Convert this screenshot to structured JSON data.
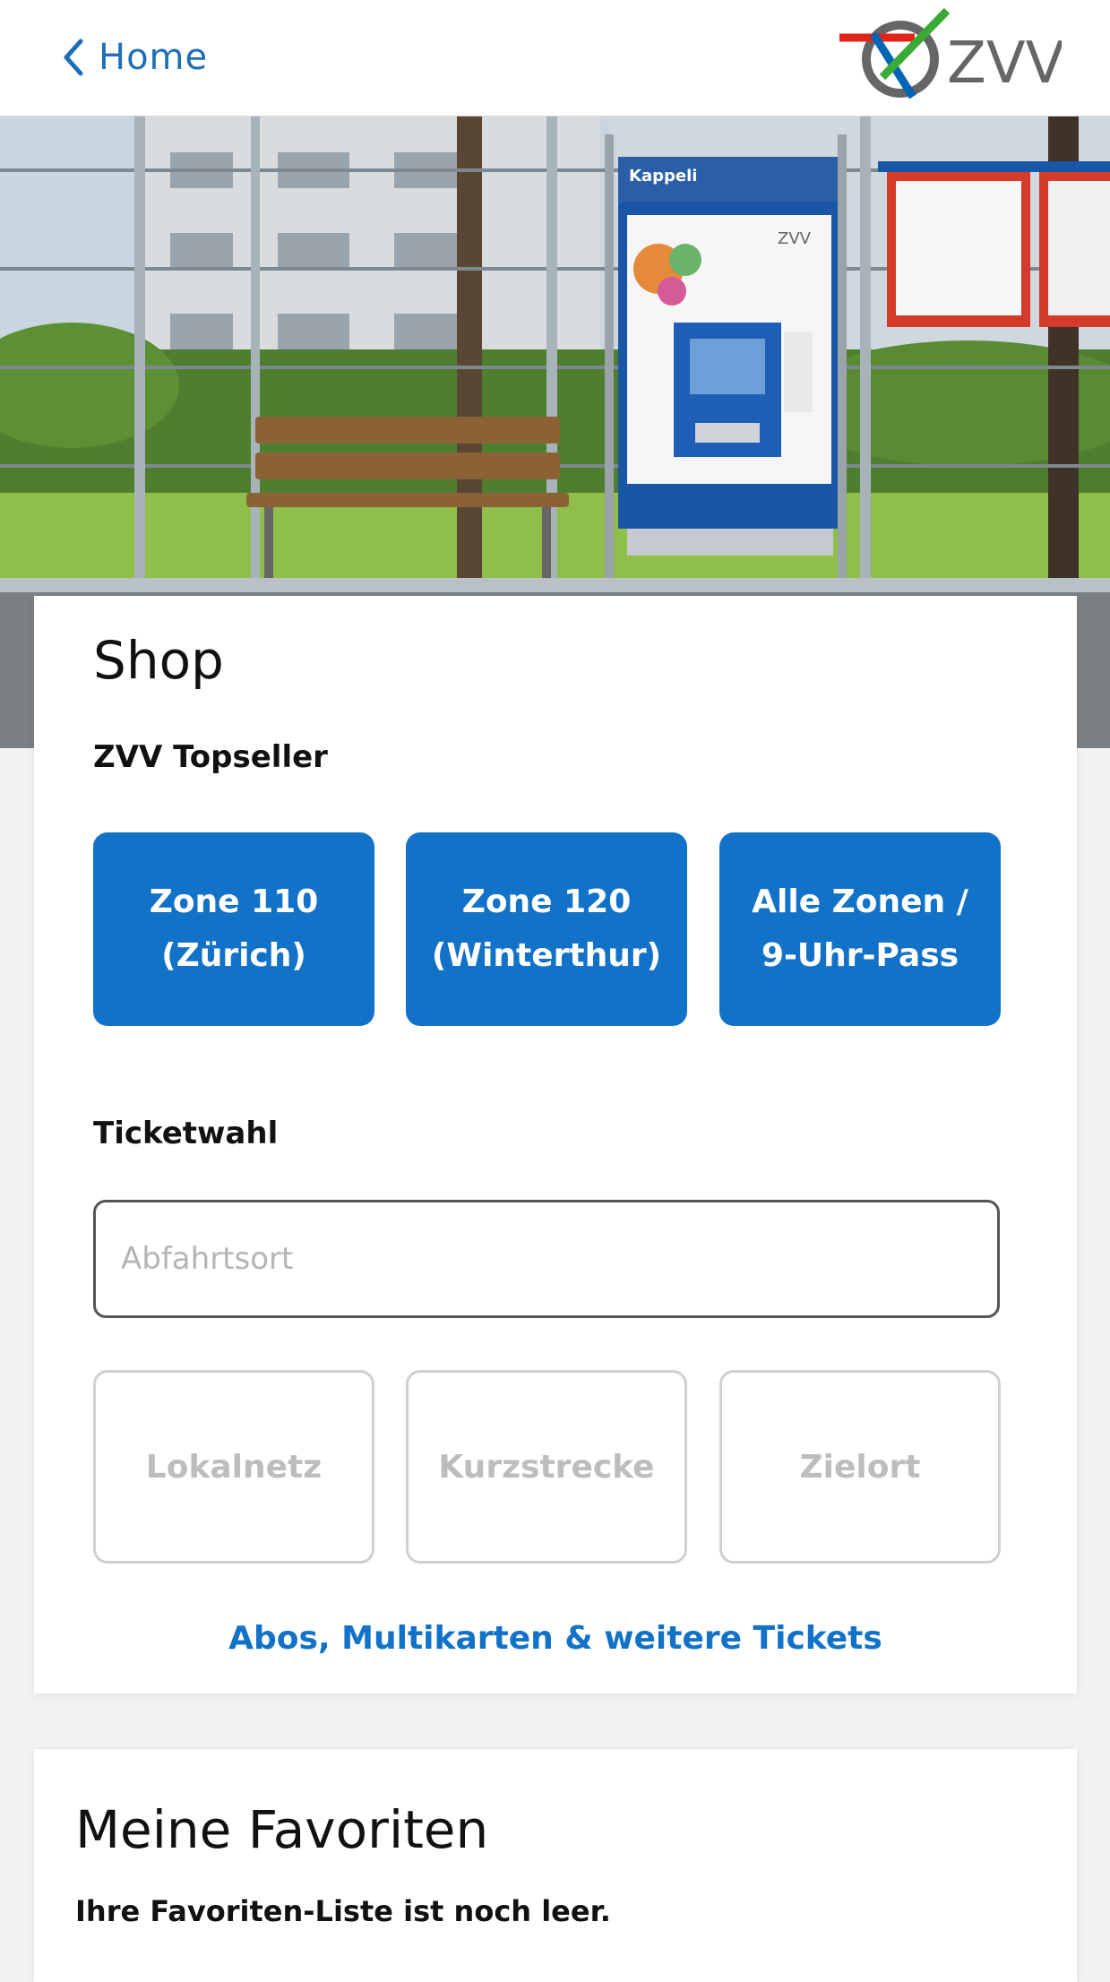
{
  "header": {
    "back_label": "Home",
    "logo_text": "ZVV"
  },
  "hero": {
    "sign_text": "Kappeli",
    "machine_logo_text": "ZVV"
  },
  "shop": {
    "title": "Shop",
    "topseller_heading": "ZVV Topseller",
    "topsellers": [
      {
        "line1": "Zone 110",
        "line2": "(Zürich)"
      },
      {
        "line1": "Zone 120",
        "line2": "(Winterthur)"
      },
      {
        "line1": "Alle Zonen /",
        "line2": "9-Uhr-Pass"
      }
    ],
    "ticketwahl_heading": "Ticketwahl",
    "departure_placeholder": "Abfahrtsort",
    "ticket_types": [
      "Lokalnetz",
      "Kurzstrecke",
      "Zielort"
    ],
    "more_tickets_link": "Abos, Multikarten & weitere Tickets"
  },
  "favorites": {
    "title": "Meine Favoriten",
    "empty_text": "Ihre Favoriten-Liste ist noch leer."
  },
  "colors": {
    "accent": "#1272c8",
    "link": "#1e6fb8",
    "logo_red": "#e2231a",
    "logo_green": "#3aaa35",
    "logo_blue": "#0066b3",
    "logo_gray": "#666666"
  }
}
